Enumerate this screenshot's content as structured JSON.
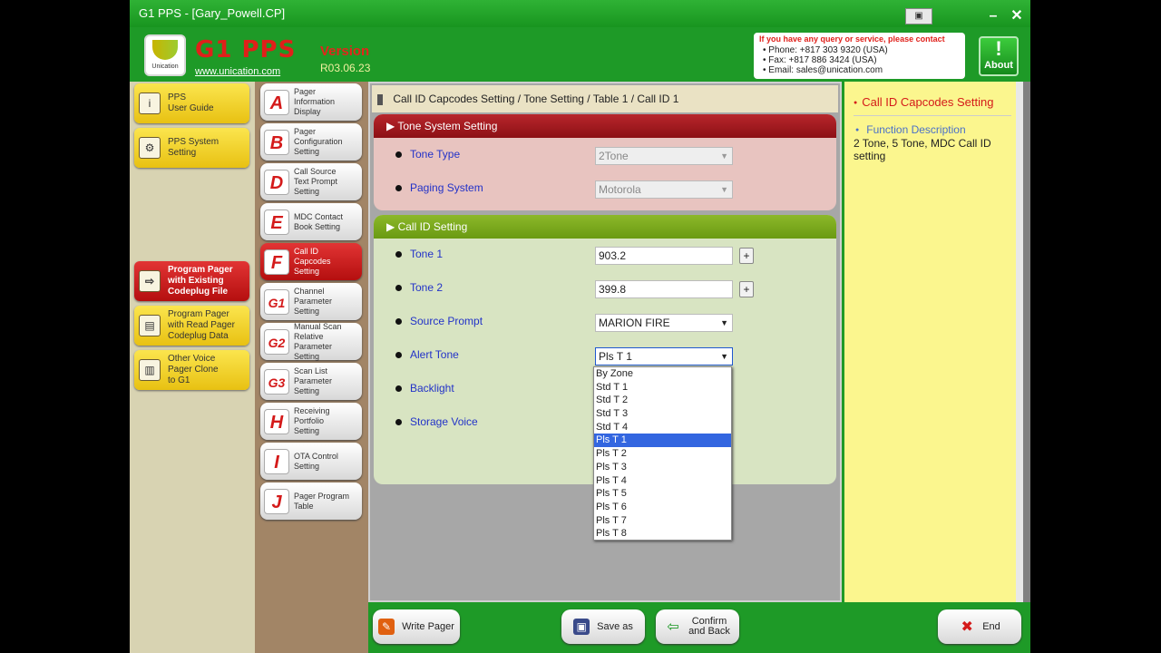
{
  "window": {
    "title": "G1 PPS - [Gary_Powell.CP]",
    "minimize_label": "–",
    "close_label": "✕",
    "restore_label": "▣"
  },
  "header": {
    "logo_text": "Unication",
    "brand": "G1 PPS",
    "website": "www.unication.com",
    "version_label": "Version",
    "version_value": "R03.06.23",
    "contact": {
      "heading": "If you have any query or service, please contact",
      "phone": "• Phone: +817 303 9320 (USA)",
      "fax": "• Fax:     +817 886 3424 (USA)",
      "email": "• Email:   sales@unication.com"
    },
    "about_label": "About"
  },
  "left_nav": [
    {
      "label": "PPS\nUser Guide",
      "icon": "info-icon",
      "glyph": "i"
    },
    {
      "label": "PPS System\nSetting",
      "icon": "settings-icon",
      "glyph": "⚙"
    },
    {
      "label": "Program Pager\nwith Existing\nCodeplug File",
      "icon": "file-arrow-icon",
      "glyph": "⇨"
    },
    {
      "label": "Program Pager\nwith Read Pager\nCodeplug Data",
      "icon": "pager-read-icon",
      "glyph": "▤"
    },
    {
      "label": "Other Voice\nPager Clone\nto G1",
      "icon": "pager-clone-icon",
      "glyph": "▥"
    }
  ],
  "page_nav": [
    {
      "letter": "A",
      "label": "Pager\nInformation\nDisplay"
    },
    {
      "letter": "B",
      "label": "Pager\nConfiguration\nSetting"
    },
    {
      "letter": "D",
      "label": "Call Source\nText Prompt\nSetting"
    },
    {
      "letter": "E",
      "label": "MDC Contact\nBook Setting"
    },
    {
      "letter": "F",
      "label": "Call ID\nCapcodes\nSetting"
    },
    {
      "letter": "G1",
      "label": "Channel\nParameter\nSetting"
    },
    {
      "letter": "G2",
      "label": "Manual Scan\nRelative\nParameter\nSetting"
    },
    {
      "letter": "G3",
      "label": "Scan List\nParameter\nSetting"
    },
    {
      "letter": "H",
      "label": "Receiving\nPortfolio\nSetting"
    },
    {
      "letter": "I",
      "label": "OTA Control\nSetting"
    },
    {
      "letter": "J",
      "label": "Pager Program\nTable"
    }
  ],
  "breadcrumb": "Call ID Capcodes Setting / Tone Setting / Table 1 / Call ID 1",
  "tone_system": {
    "title": "▶ Tone System Setting",
    "tone_type_label": "Tone Type",
    "tone_type_value": "2Tone",
    "paging_system_label": "Paging System",
    "paging_system_value": "Motorola"
  },
  "call_id": {
    "title": "▶ Call ID Setting",
    "tone1_label": "Tone 1",
    "tone1_value": "903.2",
    "tone2_label": "Tone 2",
    "tone2_value": "399.8",
    "source_prompt_label": "Source Prompt",
    "source_prompt_value": "MARION FIRE",
    "alert_tone_label": "Alert Tone",
    "alert_tone_value": "Pls T 1",
    "backlight_label": "Backlight",
    "storage_voice_label": "Storage Voice",
    "plus_label": "+"
  },
  "alert_tone_options": [
    "By Zone",
    "Std T 1",
    "Std T 2",
    "Std T 3",
    "Std T 4",
    "Pls T 1",
    "Pls T 2",
    "Pls T 3",
    "Pls T 4",
    "Pls T 5",
    "Pls T 6",
    "Pls T 7",
    "Pls T 8"
  ],
  "alert_tone_selected_index": 5,
  "help": {
    "title": "Call ID Capcodes Setting",
    "subtitle": "Function Description",
    "description": "2 Tone, 5 Tone, MDC Call ID setting"
  },
  "footer": {
    "write_pager": "Write Pager",
    "save_as": "Save as",
    "confirm_back": "Confirm\nand Back",
    "end": "End"
  },
  "colors": {
    "green": "#1e9a27",
    "red": "#d41a1a",
    "yellow": "#fbe54e",
    "tone_panel": "#e4c0bc",
    "callid_panel": "#d8e4c2"
  }
}
